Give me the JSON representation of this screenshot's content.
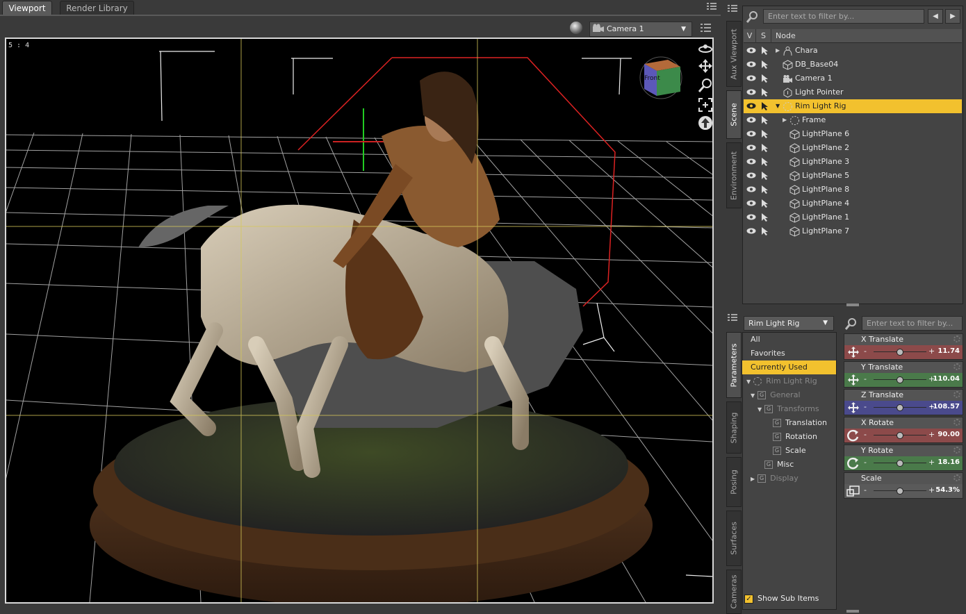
{
  "tabs": {
    "viewport": "Viewport",
    "render_library": "Render Library"
  },
  "viewport": {
    "camera": "Camera 1",
    "aspect": "5 : 4",
    "gizmo_label": "Front"
  },
  "side_tabs_top": [
    "Aux Viewport",
    "Scene",
    "Environment"
  ],
  "side_tabs_bottom": [
    "Parameters",
    "Shaping",
    "Posing",
    "Surfaces",
    "Cameras"
  ],
  "scene": {
    "filter_placeholder": "Enter text to filter by...",
    "columns": {
      "v": "V",
      "s": "S",
      "node": "Node"
    },
    "nodes": [
      {
        "label": "Chara",
        "icon": "figure-icon",
        "expander": "▶",
        "indent": 0
      },
      {
        "label": "DB_Base04",
        "icon": "prop-icon",
        "expander": "",
        "indent": 0
      },
      {
        "label": "Camera 1",
        "icon": "camera-icon",
        "expander": "",
        "indent": 0
      },
      {
        "label": "Light Pointer",
        "icon": "light-icon",
        "expander": "",
        "indent": 0
      },
      {
        "label": "Rim Light Rig",
        "icon": "group-icon",
        "expander": "▼",
        "indent": 0,
        "selected": true
      },
      {
        "label": "Frame",
        "icon": "group-icon",
        "expander": "▶",
        "indent": 1
      },
      {
        "label": "LightPlane 6",
        "icon": "prop-icon",
        "expander": "",
        "indent": 1
      },
      {
        "label": "LightPlane 2",
        "icon": "prop-icon",
        "expander": "",
        "indent": 1
      },
      {
        "label": "LightPlane 3",
        "icon": "prop-icon",
        "expander": "",
        "indent": 1
      },
      {
        "label": "LightPlane 5",
        "icon": "prop-icon",
        "expander": "",
        "indent": 1
      },
      {
        "label": "LightPlane 8",
        "icon": "prop-icon",
        "expander": "",
        "indent": 1
      },
      {
        "label": "LightPlane 4",
        "icon": "prop-icon",
        "expander": "",
        "indent": 1
      },
      {
        "label": "LightPlane 1",
        "icon": "prop-icon",
        "expander": "",
        "indent": 1
      },
      {
        "label": "LightPlane 7",
        "icon": "prop-icon",
        "expander": "",
        "indent": 1
      }
    ]
  },
  "parameters": {
    "node_select": "Rim Light Rig",
    "filter_placeholder": "Enter text to filter by...",
    "tree": [
      {
        "label": "All",
        "type": "item"
      },
      {
        "label": "Favorites",
        "type": "item"
      },
      {
        "label": "Currently Used",
        "type": "item",
        "selected": true
      },
      {
        "label": "Rim Light Rig",
        "type": "node",
        "dim": true,
        "expander": "▼"
      },
      {
        "label": "General",
        "type": "group",
        "dim": true,
        "expander": "▼"
      },
      {
        "label": "Transforms",
        "type": "group",
        "dim": true,
        "expander": "▼"
      },
      {
        "label": "Translation",
        "type": "group"
      },
      {
        "label": "Rotation",
        "type": "group"
      },
      {
        "label": "Scale",
        "type": "group"
      },
      {
        "label": "Misc",
        "type": "group"
      },
      {
        "label": "Display",
        "type": "group",
        "dim": true,
        "expander": "▶"
      }
    ],
    "sliders": [
      {
        "label": "X Translate",
        "value": "11.74",
        "color": "#8c4a4a",
        "icon": "move-icon",
        "level": 0.5
      },
      {
        "label": "Y Translate",
        "value": "110.04",
        "color": "#4a7a4a",
        "icon": "move-icon",
        "level": 0.5
      },
      {
        "label": "Z Translate",
        "value": "-108.57",
        "color": "#4a4a8c",
        "icon": "move-icon",
        "level": 0.5
      },
      {
        "label": "X Rotate",
        "value": "90.00",
        "color": "#8c4a4a",
        "icon": "rotate-icon",
        "level": 0.5
      },
      {
        "label": "Y Rotate",
        "value": "18.16",
        "color": "#4a7a4a",
        "icon": "rotate-icon",
        "level": 0.5
      },
      {
        "label": "Scale",
        "value": "54.3%",
        "color": "#5a5a5a",
        "icon": "scale-icon",
        "level": 0.5
      }
    ],
    "show_sub_items": "Show Sub Items"
  },
  "colors": {
    "accent": "#f2c12e",
    "panel": "#3a3a3a"
  }
}
